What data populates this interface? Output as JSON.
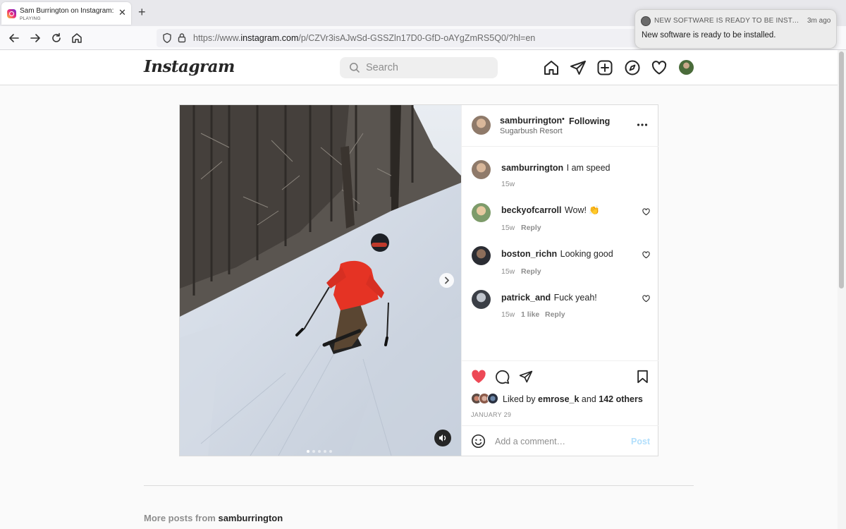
{
  "browser": {
    "tab_title": "Sam Burrington on Instagram: \"I am speed\"",
    "tab_status": "PLAYING",
    "url_prefix": "https://www.",
    "url_domain": "instagram.com",
    "url_path": "/p/CZVr3isAJwSd-GSSZln17D0-GfD-oAYgZmRS5Q0/?hl=en"
  },
  "notification": {
    "title": "NEW SOFTWARE IS READY TO BE INSTALLED",
    "time": "3m ago",
    "body": "New software is ready to be installed."
  },
  "header": {
    "logo": "Instagram",
    "search_placeholder": "Search"
  },
  "post": {
    "author": "samburrington",
    "separator": "•",
    "follow_status": "Following",
    "location": "Sugarbush Resort",
    "caption": {
      "user": "samburrington",
      "text": "I am speed",
      "age": "15w"
    },
    "comments": [
      {
        "user": "beckyofcarroll",
        "text": "Wow! 👏",
        "age": "15w",
        "likes": "",
        "reply": "Reply"
      },
      {
        "user": "boston_richn",
        "text": "Looking good",
        "age": "15w",
        "likes": "",
        "reply": "Reply"
      },
      {
        "user": "patrick_and",
        "text": "Fuck yeah!",
        "age": "15w",
        "likes": "1 like",
        "reply": "Reply"
      }
    ],
    "liked_by_prefix": "Liked by",
    "liked_by_user": "emrose_k",
    "liked_by_and": "and",
    "liked_by_others": "142 others",
    "date": "JANUARY 29",
    "comment_placeholder": "Add a comment…",
    "post_button": "Post",
    "carousel": {
      "slide_count": 5,
      "current_slide": 1
    }
  },
  "more_posts": {
    "prefix": "More posts from",
    "user": "samburrington"
  },
  "colors": {
    "like_red": "#ed4956",
    "post_blue_disabled": "#b2dffc",
    "text_primary": "#262626",
    "text_muted": "#8e8e8e"
  },
  "icons": [
    "back-icon",
    "forward-icon",
    "reload-icon",
    "home-icon",
    "shield-icon",
    "lock-icon",
    "search-icon",
    "home-icon",
    "direct-icon",
    "new-post-icon",
    "explore-icon",
    "activity-heart-icon",
    "heart-icon",
    "comment-icon",
    "share-icon",
    "save-icon",
    "emoji-icon",
    "volume-icon",
    "chevron-right-icon"
  ]
}
